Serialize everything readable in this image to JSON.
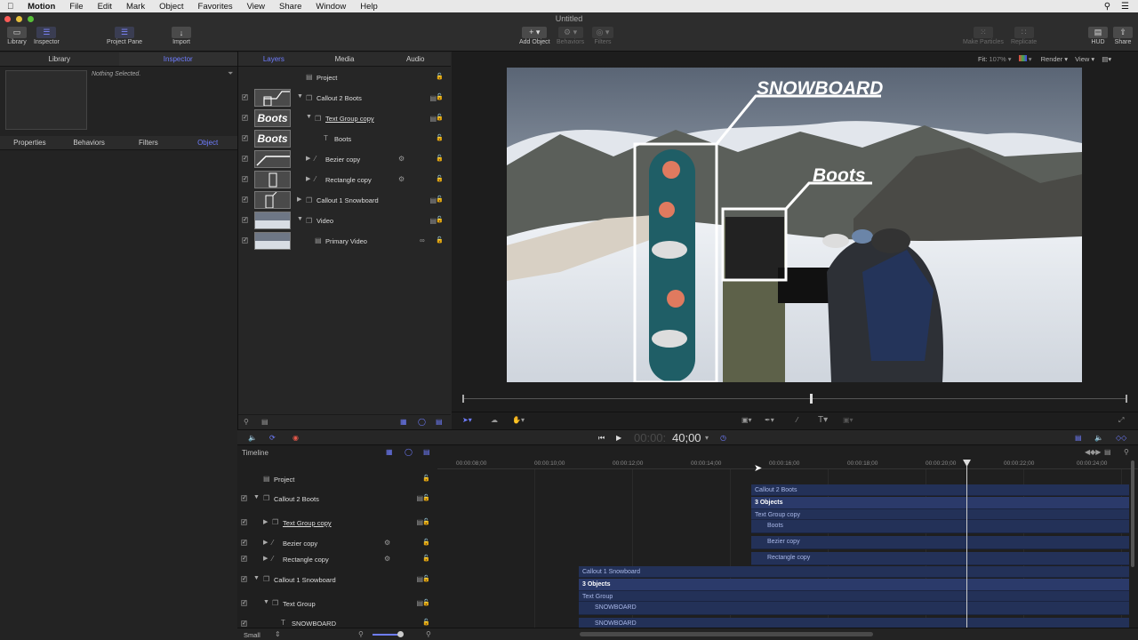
{
  "menubar": {
    "app": "Motion",
    "items": [
      "File",
      "Edit",
      "Mark",
      "Object",
      "Favorites",
      "View",
      "Share",
      "Window",
      "Help"
    ]
  },
  "window": {
    "title": "Untitled"
  },
  "toolbar": {
    "library": "Library",
    "inspector": "Inspector",
    "project_pane": "Project Pane",
    "import": "Import",
    "add_object": "Add Object",
    "behaviors": "Behaviors",
    "filters": "Filters",
    "make_particles": "Make Particles",
    "replicate": "Replicate",
    "hud": "HUD",
    "share": "Share"
  },
  "left_panel": {
    "tabs": [
      "Library",
      "Inspector"
    ],
    "nothing_selected": "Nothing Selected.",
    "inspector_tabs": [
      "Properties",
      "Behaviors",
      "Filters",
      "Object"
    ]
  },
  "layers_panel": {
    "tabs": [
      "Layers",
      "Media",
      "Audio"
    ],
    "project": "Project",
    "rows": [
      {
        "name": "Callout 2 Boots",
        "thumb": ""
      },
      {
        "name": "Text Group copy",
        "thumb": "Boots"
      },
      {
        "name": "Boots",
        "thumb": "Boots"
      },
      {
        "name": "Bezier copy",
        "thumb": ""
      },
      {
        "name": "Rectangle copy",
        "thumb": ""
      },
      {
        "name": "Callout 1 Snowboard",
        "thumb": ""
      },
      {
        "name": "Video",
        "thumb": ""
      },
      {
        "name": "Primary Video",
        "thumb": ""
      }
    ]
  },
  "canvas": {
    "fit_label": "Fit:",
    "fit_value": "107%",
    "render": "Render",
    "view": "View",
    "callout_snowboard": "SNOWBOARD",
    "callout_boots": "Boots"
  },
  "transport": {
    "timecode_dim": "00:00:",
    "timecode": "40;00"
  },
  "timeline": {
    "label": "Timeline",
    "ruler": [
      "00:00:08;00",
      "00:00:10;00",
      "00:00:12;00",
      "00:00:14;00",
      "00:00:16;00",
      "00:00:18;00",
      "00:00:20;00",
      "00:00:22;00",
      "00:00:24;00"
    ],
    "rows": [
      "Project",
      "Callout 2 Boots",
      "Text Group copy",
      "Bezier copy",
      "Rectangle copy",
      "Callout 1 Snowboard",
      "Text Group",
      "SNOWBOARD"
    ],
    "clips_boots": [
      "Callout 2 Boots",
      "3 Objects",
      "Text Group copy",
      "Boots",
      "Bezier copy",
      "Rectangle copy"
    ],
    "clips_snow": [
      "Callout 1 Snowboard",
      "3 Objects",
      "Text Group",
      "SNOWBOARD",
      "SNOWBOARD"
    ],
    "size": "Small"
  }
}
